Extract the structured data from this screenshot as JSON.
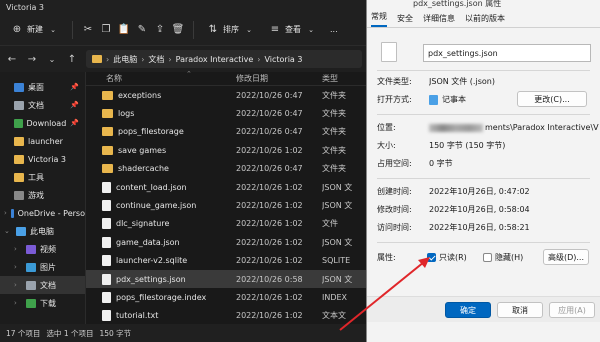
{
  "window": {
    "title": "Victoria 3"
  },
  "toolbar": {
    "new_label": "新建",
    "sort_label": "排序",
    "view_label": "查看",
    "more_label": "..."
  },
  "address": {
    "crumbs": [
      "此电脑",
      "文档",
      "Paradox Interactive",
      "Victoria 3"
    ]
  },
  "sidebar": {
    "items": [
      {
        "label": "桌面",
        "icon": "desktop-icon",
        "color": "#3b82d6",
        "pinned": true
      },
      {
        "label": "文档",
        "icon": "documents-icon",
        "color": "#9aa3ad",
        "pinned": true
      },
      {
        "label": "Download",
        "icon": "downloads-icon",
        "color": "#3fa14b",
        "pinned": true
      },
      {
        "label": "launcher",
        "icon": "folder-icon",
        "color": "#e8b64d",
        "pinned": false
      },
      {
        "label": "Victoria 3",
        "icon": "folder-icon",
        "color": "#e8b64d",
        "pinned": false
      },
      {
        "label": "工具",
        "icon": "folder-icon",
        "color": "#e8b64d",
        "pinned": false
      },
      {
        "label": "游戏",
        "icon": "games-icon",
        "color": "#888888",
        "pinned": false
      },
      {
        "label": "OneDrive - Perso",
        "icon": "cloud-icon",
        "color": "#3b82d6",
        "pinned": false
      },
      {
        "label": "此电脑",
        "icon": "computer-icon",
        "color": "#4aa0e6",
        "pinned": false
      },
      {
        "label": "视频",
        "icon": "videos-icon",
        "color": "#7b5bd6",
        "pinned": false
      },
      {
        "label": "图片",
        "icon": "pictures-icon",
        "color": "#3b9ad6",
        "pinned": false
      },
      {
        "label": "文档",
        "icon": "documents-icon",
        "color": "#9aa3ad",
        "pinned": false
      },
      {
        "label": "下载",
        "icon": "downloads-icon",
        "color": "#3fa14b",
        "pinned": false
      }
    ]
  },
  "filelist": {
    "headers": {
      "name": "名称",
      "date": "修改日期",
      "type": "类型"
    },
    "rows": [
      {
        "name": "exceptions",
        "date": "2022/10/26 0:47",
        "type": "文件夹",
        "kind": "folder"
      },
      {
        "name": "logs",
        "date": "2022/10/26 0:47",
        "type": "文件夹",
        "kind": "folder"
      },
      {
        "name": "pops_filestorage",
        "date": "2022/10/26 0:47",
        "type": "文件夹",
        "kind": "folder"
      },
      {
        "name": "save games",
        "date": "2022/10/26 1:02",
        "type": "文件夹",
        "kind": "folder"
      },
      {
        "name": "shadercache",
        "date": "2022/10/26 0:47",
        "type": "文件夹",
        "kind": "folder"
      },
      {
        "name": "content_load.json",
        "date": "2022/10/26 1:02",
        "type": "JSON 文",
        "kind": "file"
      },
      {
        "name": "continue_game.json",
        "date": "2022/10/26 1:02",
        "type": "JSON 文",
        "kind": "file"
      },
      {
        "name": "dlc_signature",
        "date": "2022/10/26 1:02",
        "type": "文件",
        "kind": "file"
      },
      {
        "name": "game_data.json",
        "date": "2022/10/26 1:02",
        "type": "JSON 文",
        "kind": "file"
      },
      {
        "name": "launcher-v2.sqlite",
        "date": "2022/10/26 1:02",
        "type": "SQLITE",
        "kind": "file"
      },
      {
        "name": "pdx_settings.json",
        "date": "2022/10/26 0:58",
        "type": "JSON 文",
        "kind": "file",
        "selected": true
      },
      {
        "name": "pops_filestorage.index",
        "date": "2022/10/26 1:02",
        "type": "INDEX",
        "kind": "file"
      },
      {
        "name": "tutorial.txt",
        "date": "2022/10/26 1:02",
        "type": "文本文",
        "kind": "file"
      }
    ]
  },
  "status": {
    "count": "17 个项目",
    "selected": "选中 1 个项目",
    "size": "150 字节"
  },
  "props": {
    "title": "pdx_settings.json 属性",
    "tabs": [
      "常规",
      "安全",
      "详细信息",
      "以前的版本"
    ],
    "filename": "pdx_settings.json",
    "type_label": "文件类型:",
    "type_value": "JSON 文件 (.json)",
    "open_label": "打开方式:",
    "open_value": "记事本",
    "change_button": "更改(C)...",
    "location_label": "位置:",
    "location_value": "ments\\Paradox Interactive\\V",
    "size_label": "大小:",
    "size_value": "150 字节 (150 字节)",
    "disk_label": "占用空间:",
    "disk_value": "0 字节",
    "created_label": "创建时间:",
    "created_value": "2022年10月26日, 0:47:02",
    "modified_label": "修改时间:",
    "modified_value": "2022年10月26日, 0:58:04",
    "accessed_label": "访问时间:",
    "accessed_value": "2022年10月26日, 0:58:21",
    "attr_label": "属性:",
    "readonly_label": "只读(R)",
    "readonly_checked": true,
    "hidden_label": "隐藏(H)",
    "hidden_checked": false,
    "advanced_button": "高级(D)...",
    "ok_button": "确定",
    "cancel_button": "取消",
    "apply_button": "应用(A)"
  }
}
